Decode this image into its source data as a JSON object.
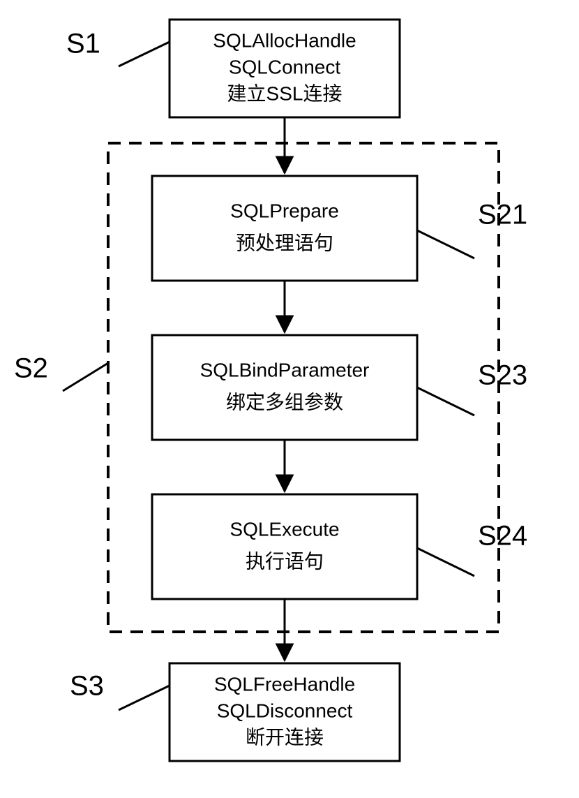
{
  "nodes": {
    "s1": {
      "line1": "SQLAllocHandle",
      "line2": "SQLConnect",
      "line3": "建立SSL连接"
    },
    "s21": {
      "line1": "SQLPrepare",
      "line2": "预处理语句"
    },
    "s23": {
      "line1": "SQLBindParameter",
      "line2": "绑定多组参数"
    },
    "s24": {
      "line1": "SQLExecute",
      "line2": "执行语句"
    },
    "s3": {
      "line1": "SQLFreeHandle",
      "line2": "SQLDisconnect",
      "line3": "断开连接"
    }
  },
  "labels": {
    "s1": "S1",
    "s2": "S2",
    "s21": "S21",
    "s23": "S23",
    "s24": "S24",
    "s3": "S3"
  }
}
